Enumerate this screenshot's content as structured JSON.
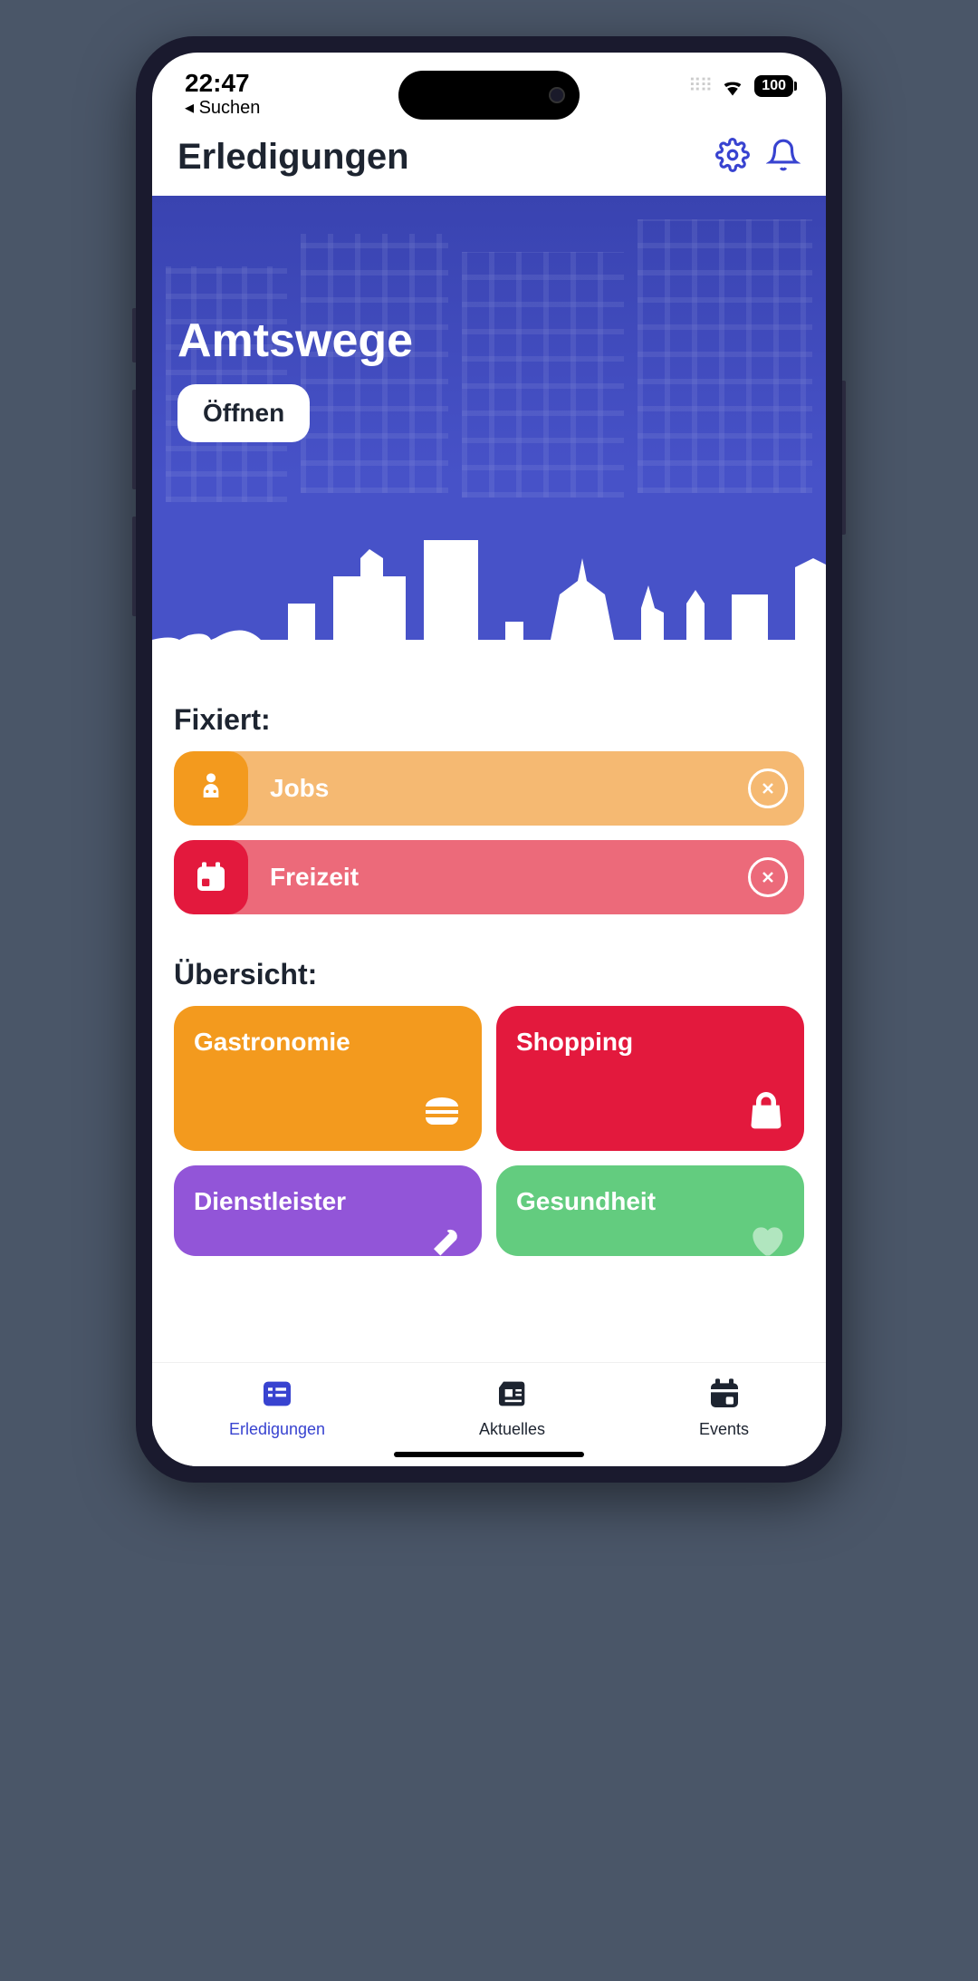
{
  "status_bar": {
    "time": "22:47",
    "back_label": "◂ Suchen",
    "battery": "100"
  },
  "header": {
    "title": "Erledigungen"
  },
  "hero": {
    "title": "Amtswege",
    "open_button": "Öffnen"
  },
  "pinned": {
    "section_title": "Fixiert:",
    "items": [
      {
        "label": "Jobs",
        "icon": "robot-icon"
      },
      {
        "label": "Freizeit",
        "icon": "calendar-icon"
      }
    ]
  },
  "overview": {
    "section_title": "Übersicht:",
    "cards": [
      {
        "label": "Gastronomie",
        "icon": "burger-icon",
        "color": "orange"
      },
      {
        "label": "Shopping",
        "icon": "bag-icon",
        "color": "red"
      },
      {
        "label": "Dienstleister",
        "icon": "wrench-icon",
        "color": "purple"
      },
      {
        "label": "Gesundheit",
        "icon": "heart-icon",
        "color": "green"
      }
    ]
  },
  "tabs": {
    "items": [
      {
        "label": "Erledigungen",
        "icon": "list-icon",
        "active": true
      },
      {
        "label": "Aktuelles",
        "icon": "news-icon",
        "active": false
      },
      {
        "label": "Events",
        "icon": "calendar-icon",
        "active": false
      }
    ]
  }
}
